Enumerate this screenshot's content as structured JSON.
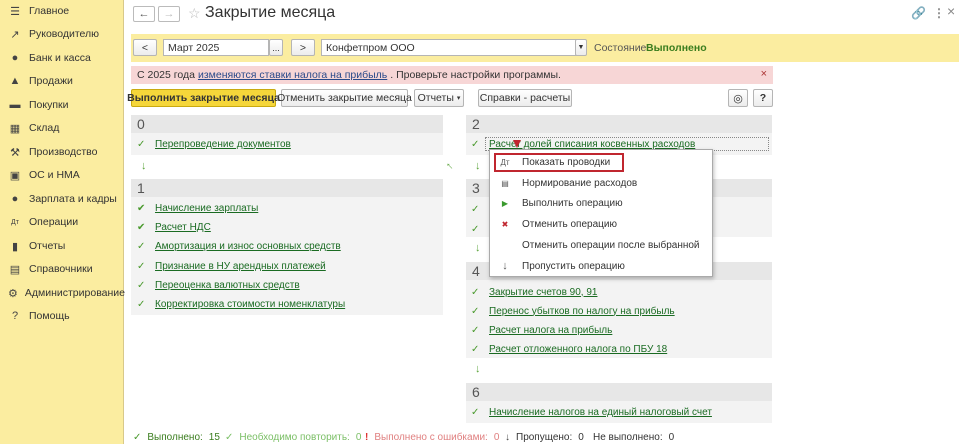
{
  "sidebar": {
    "items": [
      {
        "icon": "menu-icon",
        "glyph": "☰",
        "label": "Главное"
      },
      {
        "icon": "trend-icon",
        "glyph": "↗",
        "label": "Руководителю"
      },
      {
        "icon": "bank-icon",
        "glyph": "●",
        "label": "Банк и касса"
      },
      {
        "icon": "sales-icon",
        "glyph": "▲",
        "label": "Продажи"
      },
      {
        "icon": "cart-icon",
        "glyph": "▬",
        "label": "Покупки"
      },
      {
        "icon": "warehouse-icon",
        "glyph": "▦",
        "label": "Склад"
      },
      {
        "icon": "production-icon",
        "glyph": "⚒",
        "label": "Производство"
      },
      {
        "icon": "assets-icon",
        "glyph": "▣",
        "label": "ОС и НМА"
      },
      {
        "icon": "people-icon",
        "glyph": "●",
        "label": "Зарплата и кадры"
      },
      {
        "icon": "operations-icon",
        "glyph": "Дт",
        "label": "Операции"
      },
      {
        "icon": "reports-icon",
        "glyph": "▮",
        "label": "Отчеты"
      },
      {
        "icon": "books-icon",
        "glyph": "▤",
        "label": "Справочники"
      },
      {
        "icon": "gear-icon",
        "glyph": "⚙",
        "label": "Администрирование"
      },
      {
        "icon": "help-icon",
        "glyph": "?",
        "label": "Помощь"
      }
    ]
  },
  "header": {
    "back": "←",
    "forward": "→",
    "title": "Закрытие месяца",
    "link_icon": "🔗",
    "more_icon": "⋮",
    "close_icon": "×"
  },
  "period": {
    "prev": "<",
    "value": "Март 2025",
    "pick": "...",
    "next": ">",
    "org": "Конфетпром ООО",
    "state_label": "Состояние:",
    "state_value": "Выполнено"
  },
  "alert": {
    "prefix": "С 2025 года",
    "link": "изменяются ставки налога на прибыль",
    "suffix": ". Проверьте настройки программы.",
    "close": "×"
  },
  "actions": {
    "run": "Выполнить закрытие месяца",
    "cancel": "Отменить закрытие месяца",
    "reports": "Отчеты",
    "reports_arrow": "▾",
    "refs": "Справки - расчеты",
    "settings_glyph": "◎",
    "help": "?"
  },
  "panels": {
    "p0": {
      "num": "0",
      "items": [
        "Перепроведение документов"
      ]
    },
    "p1": {
      "num": "1",
      "items": [
        "Начисление зарплаты",
        "Расчет НДС",
        "Амортизация и износ основных средств",
        "Признание в НУ арендных платежей",
        "Переоценка валютных средств",
        "Корректировка стоимости номенклатуры"
      ]
    },
    "p2": {
      "num": "2",
      "items": [
        "Расчет долей списания косвенных расходов"
      ]
    },
    "p3": {
      "num": "3"
    },
    "p4": {
      "num": "4",
      "items": [
        "Закрытие счетов 90, 91",
        "Перенос убытков по налогу на прибыль",
        "Расчет налога на прибыль",
        "Расчет отложенного налога по ПБУ 18"
      ]
    },
    "p6": {
      "num": "6",
      "items": [
        "Начисление налогов на единый налоговый счет"
      ]
    }
  },
  "context_menu": {
    "items": [
      {
        "icon": "postings-icon",
        "glyph": "Дт",
        "label": "Показать проводки"
      },
      {
        "icon": "norm-icon",
        "glyph": "▤",
        "label": "Нормирование расходов"
      },
      {
        "icon": "run-op-icon",
        "glyph": "▶",
        "label": "Выполнить операцию"
      },
      {
        "icon": "cancel-op-icon",
        "glyph": "✖",
        "label": "Отменить операцию"
      },
      {
        "icon": "",
        "glyph": "",
        "label": "Отменить операции после выбранной"
      },
      {
        "icon": "skip-icon",
        "glyph": "↓",
        "label": "Пропустить операцию"
      }
    ]
  },
  "status_bar": {
    "done_label": "Выполнено:",
    "done_count": "15",
    "repeat_label": "Необходимо повторить:",
    "repeat_count": "0",
    "errors_label": "Выполнено с ошибками:",
    "errors_count": "0",
    "skipped_label": "Пропущено:",
    "skipped_count": "0",
    "notdone_label": "Не выполнено:",
    "notdone_count": "0"
  },
  "colors": {
    "sidebar_bg": "#fbeda0",
    "link_green": "#1a6b22",
    "check_green": "#4a9a2e",
    "alert_bg": "#f7d6d6",
    "highlight_red": "#c0262f"
  }
}
